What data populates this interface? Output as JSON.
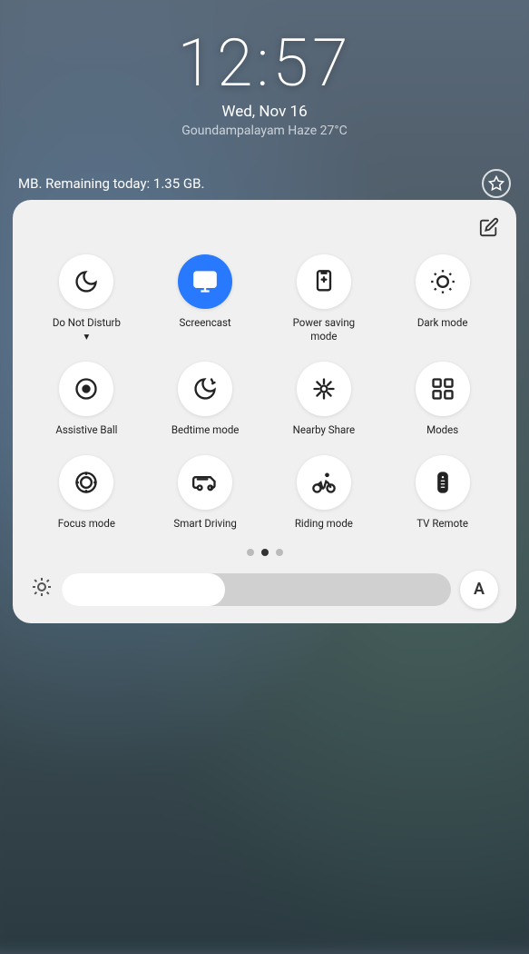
{
  "wallpaper": {},
  "statusBar": {
    "time": "12:57",
    "date": "Wed, Nov 16",
    "weather": "Goundampalayam Haze 27°C"
  },
  "dataBanner": {
    "text": "MB. Remaining today: 1.35 GB."
  },
  "panel": {
    "editLabel": "✎",
    "rows": [
      [
        {
          "id": "do-not-disturb",
          "label": "Do Not Disturb▾",
          "active": false,
          "icon": "moon"
        },
        {
          "id": "screencast",
          "label": "Screencast",
          "active": true,
          "icon": "screencast"
        },
        {
          "id": "power-saving",
          "label": "Power saving mode",
          "active": false,
          "icon": "battery"
        },
        {
          "id": "dark-mode",
          "label": "Dark mode",
          "active": false,
          "icon": "brightness"
        }
      ],
      [
        {
          "id": "assistive-ball",
          "label": "Assistive Ball",
          "active": false,
          "icon": "circle-dot"
        },
        {
          "id": "bedtime-mode",
          "label": "Bedtime mode",
          "active": false,
          "icon": "moon-star"
        },
        {
          "id": "nearby-share",
          "label": "Nearby Share",
          "active": false,
          "icon": "share-nearby"
        },
        {
          "id": "modes",
          "label": "Modes",
          "active": false,
          "icon": "grid"
        }
      ],
      [
        {
          "id": "focus-mode",
          "label": "Focus mode",
          "active": false,
          "icon": "focus"
        },
        {
          "id": "smart-driving",
          "label": "Smart Driving",
          "active": false,
          "icon": "car"
        },
        {
          "id": "riding-mode",
          "label": "Riding mode",
          "active": false,
          "icon": "bike"
        },
        {
          "id": "tv-remote",
          "label": "TV Remote",
          "active": false,
          "icon": "remote"
        }
      ]
    ],
    "pageIndicators": [
      {
        "active": false
      },
      {
        "active": true
      },
      {
        "active": false
      }
    ],
    "brightness": {
      "fillPercent": 42
    },
    "fontSizeLabel": "A"
  }
}
